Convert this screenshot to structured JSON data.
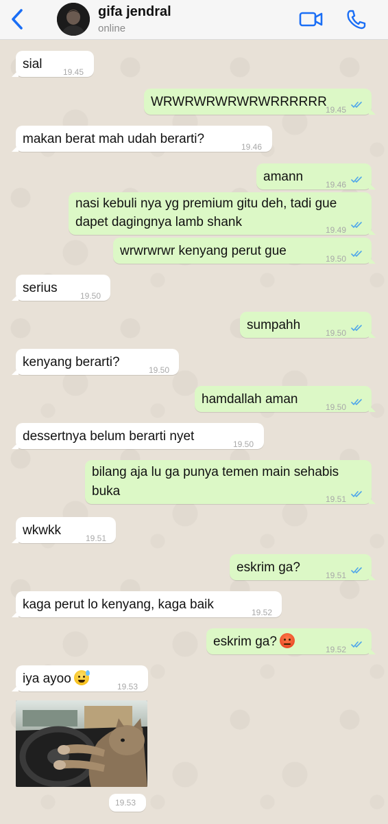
{
  "contact": {
    "name": "gifa jendral",
    "status": "online"
  },
  "icons": {
    "back": "chevron-left-icon",
    "video": "video-camera-icon",
    "call": "phone-icon",
    "read_receipt": "double-check-icon"
  },
  "colors": {
    "accent": "#1a6ef5",
    "incoming_bubble": "#ffffff",
    "outgoing_bubble": "#dcf8c6",
    "read_ticks": "#4fa6ea"
  },
  "messages": [
    {
      "dir": "in",
      "text": "sial",
      "time": "19.45"
    },
    {
      "dir": "out",
      "text": "WRWRWRWRWRWRRRRRR",
      "time": "19.45"
    },
    {
      "dir": "in",
      "text": "makan berat mah udah berarti?",
      "time": "19.46"
    },
    {
      "dir": "out",
      "text": "amann",
      "time": "19.46"
    },
    {
      "dir": "out",
      "text": "nasi kebuli nya yg premium gitu deh, tadi gue",
      "text2": "dapet dagingnya lamb shank",
      "time": "19.49"
    },
    {
      "dir": "out",
      "text": "wrwrwrwr kenyang perut gue",
      "time": "19.50"
    },
    {
      "dir": "in",
      "text": "serius",
      "time": "19.50"
    },
    {
      "dir": "out",
      "text": "sumpahh",
      "time": "19.50"
    },
    {
      "dir": "in",
      "text": "kenyang berarti?",
      "time": "19.50"
    },
    {
      "dir": "out",
      "text": "hamdallah aman",
      "time": "19.50"
    },
    {
      "dir": "in",
      "text": "dessertnya belum berarti nyet",
      "time": "19.50"
    },
    {
      "dir": "out",
      "text": "bilang aja lu ga punya temen main sehabis",
      "text2": "buka",
      "time": "19.51"
    },
    {
      "dir": "in",
      "text": "wkwkk",
      "time": "19.51"
    },
    {
      "dir": "out",
      "text": "eskrim ga?",
      "time": "19.51"
    },
    {
      "dir": "in",
      "text": "kaga perut lo kenyang, kaga baik",
      "time": "19.52"
    },
    {
      "dir": "out",
      "text": "eskrim ga?",
      "emoji": "angry-face-emoji",
      "time": "19.52"
    },
    {
      "dir": "in",
      "text": "iya ayoo",
      "emoji": "grinning-sweat-emoji",
      "time": "19.53"
    }
  ],
  "photo_message": {
    "dir": "in",
    "subject": "cat-driving-car-photo",
    "time": "19.53"
  }
}
